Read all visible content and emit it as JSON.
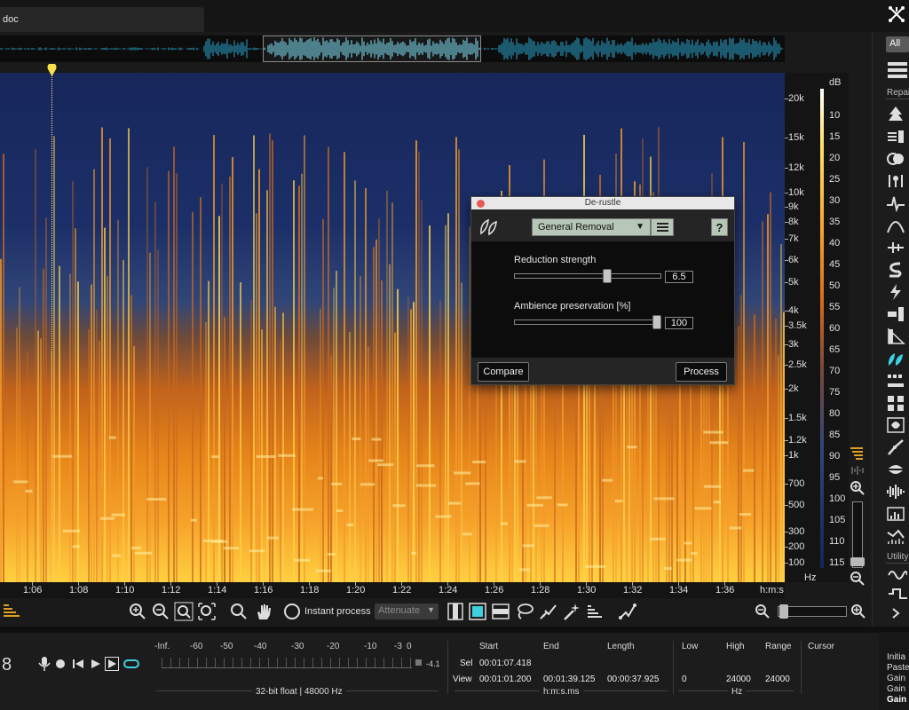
{
  "window": {
    "tab_title": "doc"
  },
  "overview": {
    "selection_note": ""
  },
  "frequency_axis": {
    "labels": [
      "20k",
      "15k",
      "12k",
      "10k",
      "9k",
      "8k",
      "7k",
      "6k",
      "5k",
      "4k",
      "3.5k",
      "3k",
      "2.5k",
      "2k",
      "1.5k",
      "1.2k",
      "1k",
      "700",
      "500",
      "300",
      "200",
      "100"
    ],
    "unit": "Hz"
  },
  "db_axis": {
    "unit": "dB",
    "labels": [
      "10",
      "15",
      "20",
      "25",
      "30",
      "35",
      "40",
      "45",
      "50",
      "55",
      "60",
      "65",
      "70",
      "75",
      "80",
      "85",
      "90",
      "95",
      "100",
      "105",
      "110",
      "115"
    ]
  },
  "time_axis": {
    "labels": [
      "1:06",
      "1:08",
      "1:10",
      "1:12",
      "1:14",
      "1:16",
      "1:18",
      "1:20",
      "1:22",
      "1:24",
      "1:26",
      "1:28",
      "1:30",
      "1:32",
      "1:34",
      "1:36"
    ],
    "unit": "h:m:s"
  },
  "toolbar": {
    "instant_process_label": "Instant process",
    "attenuate_label": "Attenuate"
  },
  "modules_panel": {
    "all_label": "All",
    "repair_label": "Repai",
    "utility_label": "Utility",
    "icons": [
      "spectral-de-noise-icon",
      "de-hum-icon",
      "de-clip-icon",
      "de-crackle-icon",
      "de-click-icon",
      "de-plosive-icon",
      "de-wind-icon",
      "de-ess-icon",
      "de-bleed-icon",
      "dialogue-isolate-icon",
      "de-reverb-icon",
      "de-rustle-icon",
      "spectral-repair-icon",
      "ambience-match-icon",
      "interpolate-icon",
      "breath-control-icon",
      "mouth-de-click-icon",
      "voice-de-noise-icon",
      "eq-match-icon",
      "spectral-recovery-icon"
    ]
  },
  "dialog": {
    "title": "De-rustle",
    "preset": "General Removal",
    "help_label": "?",
    "params": [
      {
        "label": "Reduction strength",
        "value": "6.5",
        "fraction": 0.64
      },
      {
        "label": "Ambience preservation [%]",
        "value": "100",
        "fraction": 1.0
      }
    ],
    "compare_label": "Compare",
    "process_label": "Process"
  },
  "transport": {
    "time_display": "8"
  },
  "meter": {
    "labels": [
      "-Inf.",
      "-60",
      "-50",
      "-40",
      "-30",
      "-20",
      "-10",
      "-3",
      "0"
    ],
    "peak": "-4.1",
    "format": "32-bit float | 48000 Hz"
  },
  "selection_info": {
    "headers": {
      "start": "Start",
      "end": "End",
      "length": "Length",
      "low": "Low",
      "high": "High",
      "range": "Range",
      "cursor": "Cursor"
    },
    "sel_label": "Sel",
    "view_label": "View",
    "sel_start": "00:01:07.418",
    "view_start": "00:01:01.200",
    "view_end": "00:01:39.125",
    "view_length": "00:00:37.925",
    "view_low": "0",
    "view_high": "24000",
    "view_range": "24000",
    "time_unit": "h:m:s.ms",
    "freq_unit": "Hz"
  },
  "history": {
    "items": [
      "Initia",
      "Paste",
      "Gain",
      "Gain",
      "Gain"
    ]
  }
}
